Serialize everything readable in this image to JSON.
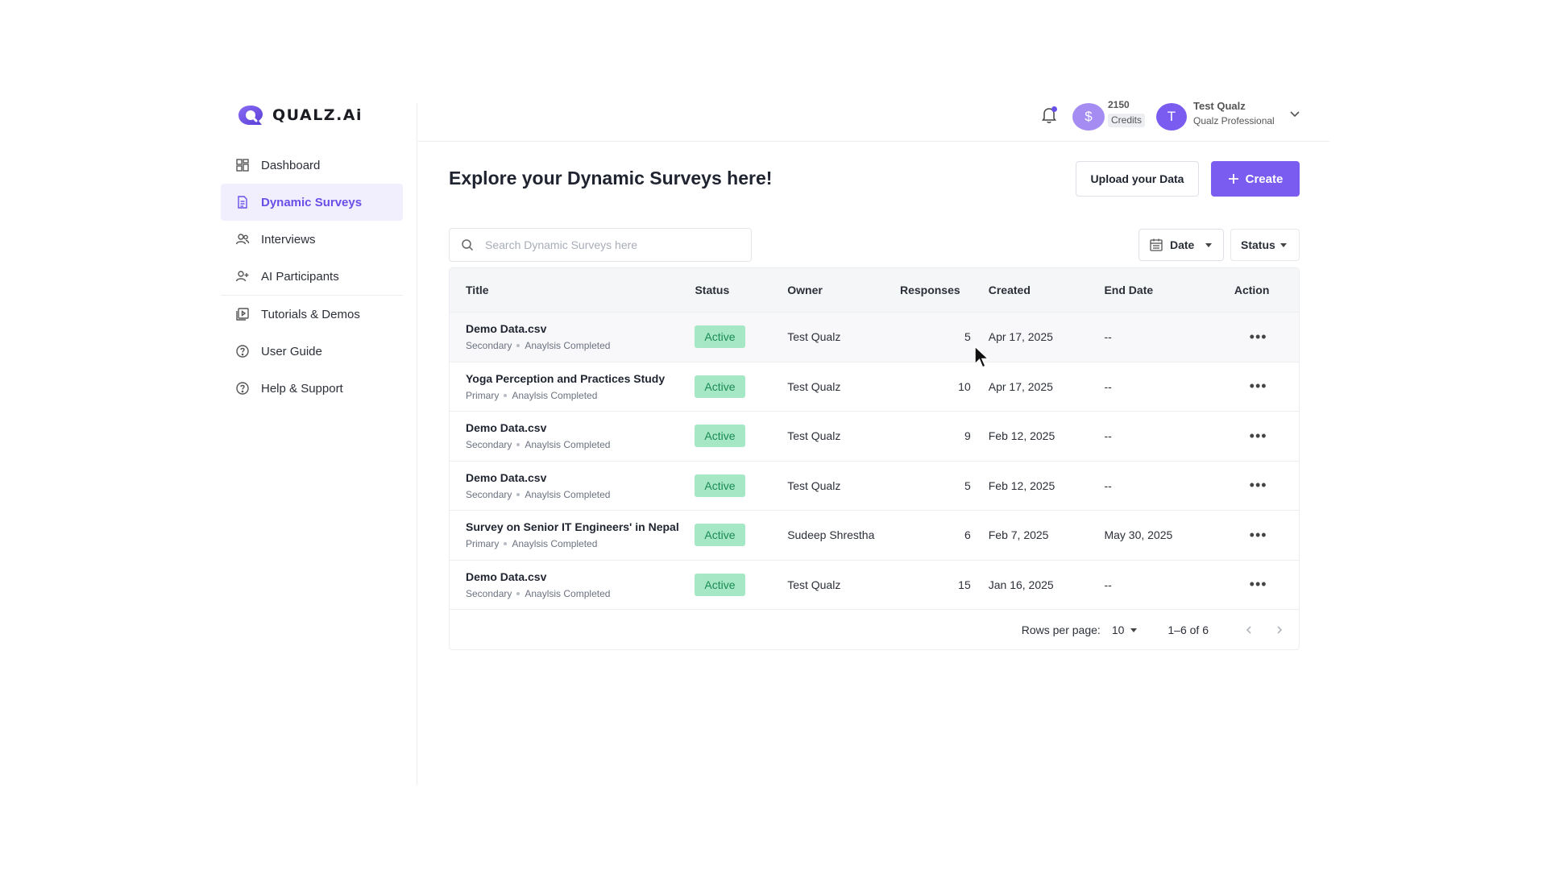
{
  "brand": {
    "name": "QUALZ.Ai"
  },
  "sidebar": {
    "items": [
      {
        "label": "Dashboard",
        "icon": "grid-icon"
      },
      {
        "label": "Dynamic Surveys",
        "icon": "document-icon",
        "active": true
      },
      {
        "label": "Interviews",
        "icon": "users-icon"
      },
      {
        "label": "AI Participants",
        "icon": "user-plus-icon"
      },
      {
        "label": "Tutorials & Demos",
        "icon": "video-library-icon"
      },
      {
        "label": "User Guide",
        "icon": "help-circle-icon"
      },
      {
        "label": "Help & Support",
        "icon": "help-circle-icon"
      }
    ]
  },
  "header": {
    "credits_value": "2150",
    "credits_label": "Credits",
    "credits_avatar": "$",
    "user_initial": "T",
    "user_name": "Test Qualz",
    "user_plan": "Qualz Professional"
  },
  "main": {
    "title": "Explore your Dynamic Surveys here!",
    "upload_label": "Upload your Data",
    "create_label": "Create",
    "search_placeholder": "Search Dynamic Surveys here",
    "filter_date": "Date",
    "filter_status": "Status"
  },
  "table": {
    "columns": [
      "Title",
      "Status",
      "Owner",
      "Responses",
      "Created",
      "End Date",
      "Action"
    ],
    "rows": [
      {
        "title": "Demo Data.csv",
        "type": "Secondary",
        "analysis": "Anaylsis Completed",
        "status": "Active",
        "owner": "Test Qualz",
        "responses": "5",
        "created": "Apr 17, 2025",
        "end_date": "--"
      },
      {
        "title": "Yoga Perception and Practices Study",
        "type": "Primary",
        "analysis": "Anaylsis Completed",
        "status": "Active",
        "owner": "Test Qualz",
        "responses": "10",
        "created": "Apr 17, 2025",
        "end_date": "--"
      },
      {
        "title": "Demo Data.csv",
        "type": "Secondary",
        "analysis": "Anaylsis Completed",
        "status": "Active",
        "owner": "Test Qualz",
        "responses": "9",
        "created": "Feb 12, 2025",
        "end_date": "--"
      },
      {
        "title": "Demo Data.csv",
        "type": "Secondary",
        "analysis": "Anaylsis Completed",
        "status": "Active",
        "owner": "Test Qualz",
        "responses": "5",
        "created": "Feb 12, 2025",
        "end_date": "--"
      },
      {
        "title": "Survey on Senior IT Engineers' in Nepal",
        "type": "Primary",
        "analysis": "Anaylsis Completed",
        "status": "Active",
        "owner": "Sudeep Shrestha",
        "responses": "6",
        "created": "Feb 7, 2025",
        "end_date": "May 30, 2025"
      },
      {
        "title": "Demo Data.csv",
        "type": "Secondary",
        "analysis": "Anaylsis Completed",
        "status": "Active",
        "owner": "Test Qualz",
        "responses": "15",
        "created": "Jan 16, 2025",
        "end_date": "--"
      }
    ],
    "action_glyph": "•••",
    "footer": {
      "rows_per_page_label": "Rows per page:",
      "rows_per_page_value": "10",
      "range": "1–6 of 6"
    }
  },
  "colors": {
    "accent": "#7a5cf0",
    "active_badge_bg": "#a6e8c6",
    "active_badge_text": "#1a8a52"
  }
}
